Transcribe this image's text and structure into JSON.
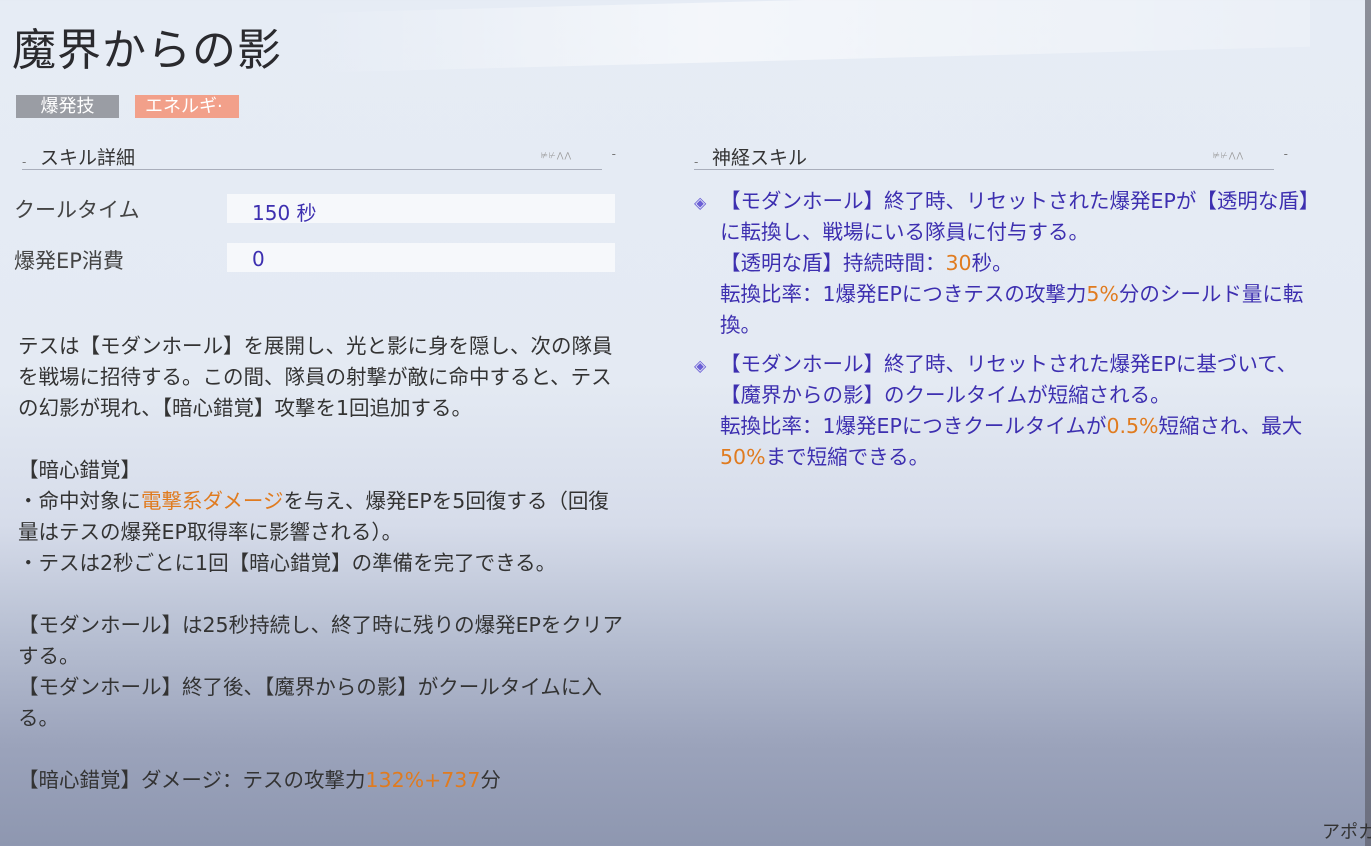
{
  "skill": {
    "title": "魔界からの影",
    "tags": [
      "爆発技",
      "エネルギ·"
    ]
  },
  "details": {
    "heading": "スキル詳細",
    "decoration": "⊭⊬⋀⋀",
    "cooldown_label": "クールタイム",
    "cooldown_value": "150 秒",
    "ep_label": "爆発EP消費",
    "ep_value": "0"
  },
  "description": {
    "p1": "テスは【モダンホール】を展開し、光と影に身を隠し、次の隊員を戦場に招待する。この間、隊員の射撃が敵に命中すると、テスの幻影が現れ、【暗心錯覚】攻撃を1回追加する。",
    "p2_title": "【暗心錯覚】",
    "p2_l1_pre": "・命中対象に",
    "p2_l1_hl": "電撃系ダメージ",
    "p2_l1_post": "を与え、爆発EPを5回復する（回復量はテスの爆発EP取得率に影響される）。",
    "p2_l2": "・テスは2秒ごとに1回【暗心錯覚】の準備を完了できる。",
    "p3_l1": "【モダンホール】は25秒持続し、終了時に残りの爆発EPをクリアする。",
    "p3_l2": "【モダンホール】終了後、【魔界からの影】がクールタイムに入る。",
    "p4_pre": "【暗心錯覚】ダメージ：テスの攻撃力",
    "p4_hl": "132%+737",
    "p4_post": "分"
  },
  "neural": {
    "heading": "神経スキル",
    "decoration": "⊭⊬⋀⋀",
    "items": [
      {
        "main": "【モダンホール】終了時、リセットされた爆発EPが【透明な盾】に転換し、戦場にいる隊員に付与する。",
        "l2_pre": "【透明な盾】持続時間：",
        "l2_hl": "30",
        "l2_post": "秒。",
        "l3_pre": "転換比率：1爆発EPにつきテスの攻撃力",
        "l3_hl": "5%",
        "l3_post": "分のシールド量に転換。"
      },
      {
        "main": "【モダンホール】終了時、リセットされた爆発EPに基づいて、【魔界からの影】のクールタイムが短縮される。",
        "l2_pre": "転換比率：1爆発EPにつきクールタイムが",
        "l2_hl": "0.5%",
        "l2_mid": "短縮され、最大",
        "l2_hl2": "50%",
        "l2_post": "まで短縮できる。"
      }
    ]
  },
  "corner_text": "アポカ",
  "colors": {
    "accent_text": "#3d2fb0",
    "highlight": "#e07b1f",
    "tag_grey": "#9a9da4",
    "tag_orange": "#f2a08a"
  }
}
